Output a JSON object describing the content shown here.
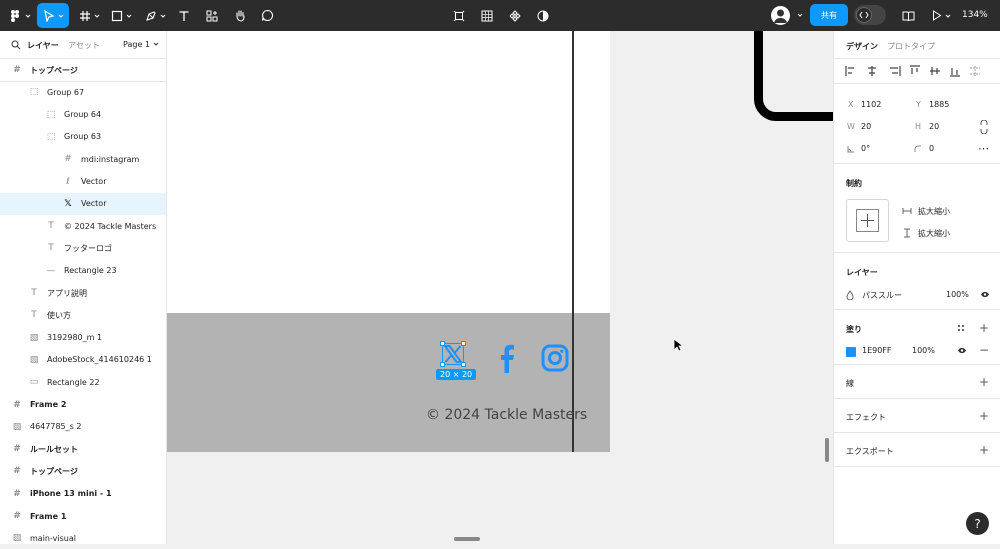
{
  "toolbar": {
    "share_label": "共有",
    "zoom": "134%"
  },
  "left_panel": {
    "tabs": {
      "layers": "レイヤー",
      "assets": "アセット",
      "page": "Page 1"
    },
    "rows": [
      {
        "label": "トップページ",
        "icon": "frame-icon",
        "indent": 0,
        "page": true
      },
      {
        "label": "Group 67",
        "icon": "group-icon",
        "indent": 1
      },
      {
        "label": "Group 64",
        "icon": "group-icon",
        "indent": 2
      },
      {
        "label": "Group 63",
        "icon": "group-icon",
        "indent": 2
      },
      {
        "label": "mdi:instagram",
        "icon": "frame-icon",
        "indent": 3
      },
      {
        "label": "Vector",
        "icon": "vector-icon",
        "indent": 3
      },
      {
        "label": "Vector",
        "icon": "x-logo-icon",
        "indent": 3,
        "selected": true
      },
      {
        "label": "© 2024 Tackle Masters",
        "icon": "text-icon",
        "indent": 2
      },
      {
        "label": "フッターロゴ",
        "icon": "text-icon",
        "indent": 2
      },
      {
        "label": "Rectangle 23",
        "icon": "line-icon",
        "indent": 2
      },
      {
        "label": "アプリ説明",
        "icon": "text-icon",
        "indent": 1
      },
      {
        "label": "使い方",
        "icon": "text-icon",
        "indent": 1
      },
      {
        "label": "3192980_m 1",
        "icon": "image-icon",
        "indent": 1
      },
      {
        "label": "AdobeStock_414610246 1",
        "icon": "image-icon",
        "indent": 1
      },
      {
        "label": "Rectangle 22",
        "icon": "rectangle-icon",
        "indent": 1
      },
      {
        "label": "Frame 2",
        "icon": "frame-icon",
        "indent": 0,
        "page": true
      },
      {
        "label": "4647785_s 2",
        "icon": "image-icon",
        "indent": 0
      },
      {
        "label": "ルールセット",
        "icon": "frame-icon",
        "indent": 0,
        "page": true
      },
      {
        "label": "トップページ",
        "icon": "frame-icon",
        "indent": 0,
        "page": true
      },
      {
        "label": "iPhone 13 mini - 1",
        "icon": "frame-icon",
        "indent": 0,
        "page": true
      },
      {
        "label": "Frame 1",
        "icon": "frame-icon",
        "indent": 0,
        "page": true
      },
      {
        "label": "main-visual",
        "icon": "image-icon",
        "indent": 0
      }
    ]
  },
  "canvas": {
    "copyright": "© 2024 Tackle Masters",
    "size_badge": "20 × 20"
  },
  "right_panel": {
    "tabs": {
      "design": "デザイン",
      "prototype": "プロトタイプ"
    },
    "position": {
      "x_label": "X",
      "x": "1102",
      "y_label": "Y",
      "y": "1885"
    },
    "size": {
      "w_label": "W",
      "w": "20",
      "h_label": "H",
      "h": "20"
    },
    "rotation": "0°",
    "radius": "0",
    "constraints": {
      "title": "制約",
      "horizontal": "拡大縮小",
      "vertical": "拡大縮小"
    },
    "layer": {
      "title": "レイヤー",
      "blend": "パススルー",
      "opacity": "100%"
    },
    "fill": {
      "title": "塗り",
      "hex": "1E90FF",
      "opacity": "100%",
      "color": "#1E90FF"
    },
    "stroke": {
      "title": "線"
    },
    "effects": {
      "title": "エフェクト"
    },
    "export": {
      "title": "エクスポート"
    }
  },
  "colors": {
    "accent": "#0D99FF",
    "toolbar": "#2C2C2C",
    "social_blue": "#1E90FF"
  }
}
